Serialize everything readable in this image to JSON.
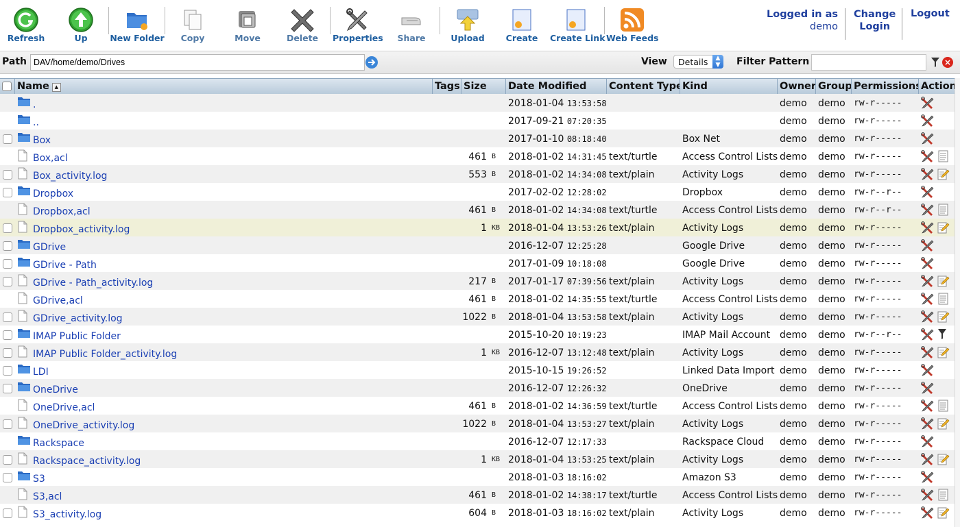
{
  "toolbar": {
    "buttons": [
      {
        "label": "Refresh",
        "icon": "refresh-icon"
      },
      {
        "label": "Up",
        "icon": "up-arrow-icon"
      },
      {
        "label": "New Folder",
        "icon": "new-folder-icon"
      },
      {
        "label": "Copy",
        "icon": "copy-icon"
      },
      {
        "label": "Move",
        "icon": "move-icon"
      },
      {
        "label": "Delete",
        "icon": "delete-x-icon"
      },
      {
        "label": "Properties",
        "icon": "wrench-screwdriver-icon"
      },
      {
        "label": "Share",
        "icon": "share-hand-icon"
      },
      {
        "label": "Upload",
        "icon": "upload-icon"
      },
      {
        "label": "Create",
        "icon": "create-file-icon"
      },
      {
        "label": "Create Link",
        "icon": "create-link-icon"
      },
      {
        "label": "Web Feeds",
        "icon": "rss-icon"
      }
    ],
    "logged_in_label": "Logged in as",
    "username": "demo",
    "change_login_line1": "Change",
    "change_login_line2": "Login",
    "logout_label": "Logout"
  },
  "pathbar": {
    "path_label": "Path",
    "path_value": "DAV/home/demo/Drives",
    "view_label": "View",
    "view_selected": "Details",
    "filter_label": "Filter Pattern",
    "filter_value": ""
  },
  "table": {
    "columns": [
      "Name",
      "Tags",
      "Size",
      "Date Modified",
      "Content Type",
      "Kind",
      "Owner",
      "Group",
      "Permissions",
      "Action"
    ],
    "rows": [
      {
        "type": "folder",
        "checkbox": false,
        "name": ".",
        "size": "",
        "unit": "",
        "date": "2018-01-04",
        "time": "13:53:58",
        "ctype": "",
        "kind": "",
        "owner": "demo",
        "group": "demo",
        "perm": "rw-r-----",
        "actions": [
          "properties"
        ]
      },
      {
        "type": "folder",
        "checkbox": false,
        "name": "..",
        "size": "",
        "unit": "",
        "date": "2017-09-21",
        "time": "07:20:35",
        "ctype": "",
        "kind": "",
        "owner": "demo",
        "group": "demo",
        "perm": "rw-r-----",
        "actions": [
          "properties"
        ]
      },
      {
        "type": "folder",
        "checkbox": true,
        "name": "Box",
        "size": "",
        "unit": "",
        "date": "2017-01-10",
        "time": "08:18:40",
        "ctype": "",
        "kind": "Box Net",
        "owner": "demo",
        "group": "demo",
        "perm": "rw-r-----",
        "actions": [
          "properties"
        ]
      },
      {
        "type": "file",
        "checkbox": false,
        "name": "Box,acl",
        "size": "461",
        "unit": "B",
        "date": "2018-01-02",
        "time": "14:31:45",
        "ctype": "text/turtle",
        "kind": "Access Control Lists",
        "owner": "demo",
        "group": "demo",
        "perm": "rw-r-----",
        "actions": [
          "properties",
          "view"
        ]
      },
      {
        "type": "file",
        "checkbox": true,
        "name": "Box_activity.log",
        "size": "553",
        "unit": "B",
        "date": "2018-01-02",
        "time": "14:34:08",
        "ctype": "text/plain",
        "kind": "Activity Logs",
        "owner": "demo",
        "group": "demo",
        "perm": "rw-r-----",
        "actions": [
          "properties",
          "edit"
        ]
      },
      {
        "type": "folder",
        "checkbox": true,
        "name": "Dropbox",
        "size": "",
        "unit": "",
        "date": "2017-02-02",
        "time": "12:28:02",
        "ctype": "",
        "kind": "Dropbox",
        "owner": "demo",
        "group": "demo",
        "perm": "rw-r--r--",
        "actions": [
          "properties"
        ]
      },
      {
        "type": "file",
        "checkbox": false,
        "name": "Dropbox,acl",
        "size": "461",
        "unit": "B",
        "date": "2018-01-02",
        "time": "14:34:08",
        "ctype": "text/turtle",
        "kind": "Access Control Lists",
        "owner": "demo",
        "group": "demo",
        "perm": "rw-r--r--",
        "actions": [
          "properties",
          "view"
        ]
      },
      {
        "type": "file",
        "checkbox": true,
        "name": "Dropbox_activity.log",
        "size": "1",
        "unit": "KB",
        "date": "2018-01-04",
        "time": "13:53:26",
        "ctype": "text/plain",
        "kind": "Activity Logs",
        "owner": "demo",
        "group": "demo",
        "perm": "rw-r-----",
        "actions": [
          "properties",
          "edit"
        ],
        "highlight": true
      },
      {
        "type": "folder",
        "checkbox": true,
        "name": "GDrive",
        "size": "",
        "unit": "",
        "date": "2016-12-07",
        "time": "12:25:28",
        "ctype": "",
        "kind": "Google Drive",
        "owner": "demo",
        "group": "demo",
        "perm": "rw-r-----",
        "actions": [
          "properties"
        ]
      },
      {
        "type": "folder",
        "checkbox": true,
        "name": "GDrive - Path",
        "size": "",
        "unit": "",
        "date": "2017-01-09",
        "time": "10:18:08",
        "ctype": "",
        "kind": "Google Drive",
        "owner": "demo",
        "group": "demo",
        "perm": "rw-r-----",
        "actions": [
          "properties"
        ]
      },
      {
        "type": "file",
        "checkbox": true,
        "name": "GDrive - Path_activity.log",
        "size": "217",
        "unit": "B",
        "date": "2017-01-17",
        "time": "07:39:56",
        "ctype": "text/plain",
        "kind": "Activity Logs",
        "owner": "demo",
        "group": "demo",
        "perm": "rw-r-----",
        "actions": [
          "properties",
          "edit"
        ]
      },
      {
        "type": "file",
        "checkbox": false,
        "name": "GDrive,acl",
        "size": "461",
        "unit": "B",
        "date": "2018-01-02",
        "time": "14:35:55",
        "ctype": "text/turtle",
        "kind": "Access Control Lists",
        "owner": "demo",
        "group": "demo",
        "perm": "rw-r-----",
        "actions": [
          "properties",
          "view"
        ]
      },
      {
        "type": "file",
        "checkbox": true,
        "name": "GDrive_activity.log",
        "size": "1022",
        "unit": "B",
        "date": "2018-01-04",
        "time": "13:53:58",
        "ctype": "text/plain",
        "kind": "Activity Logs",
        "owner": "demo",
        "group": "demo",
        "perm": "rw-r-----",
        "actions": [
          "properties",
          "edit"
        ]
      },
      {
        "type": "folder",
        "checkbox": true,
        "name": "IMAP Public Folder",
        "size": "",
        "unit": "",
        "date": "2015-10-20",
        "time": "10:19:23",
        "ctype": "",
        "kind": "IMAP Mail Account",
        "owner": "demo",
        "group": "demo",
        "perm": "rw-r--r--",
        "actions": [
          "properties",
          "filter"
        ]
      },
      {
        "type": "file",
        "checkbox": true,
        "name": "IMAP Public Folder_activity.log",
        "size": "1",
        "unit": "KB",
        "date": "2016-12-07",
        "time": "13:12:48",
        "ctype": "text/plain",
        "kind": "Activity Logs",
        "owner": "demo",
        "group": "demo",
        "perm": "rw-r-----",
        "actions": [
          "properties",
          "edit"
        ]
      },
      {
        "type": "folder",
        "checkbox": true,
        "name": "LDI",
        "size": "",
        "unit": "",
        "date": "2015-10-15",
        "time": "19:26:52",
        "ctype": "",
        "kind": "Linked Data Import",
        "owner": "demo",
        "group": "demo",
        "perm": "rw-r-----",
        "actions": [
          "properties"
        ]
      },
      {
        "type": "folder",
        "checkbox": true,
        "name": "OneDrive",
        "size": "",
        "unit": "",
        "date": "2016-12-07",
        "time": "12:26:32",
        "ctype": "",
        "kind": "OneDrive",
        "owner": "demo",
        "group": "demo",
        "perm": "rw-r-----",
        "actions": [
          "properties"
        ]
      },
      {
        "type": "file",
        "checkbox": false,
        "name": "OneDrive,acl",
        "size": "461",
        "unit": "B",
        "date": "2018-01-02",
        "time": "14:36:59",
        "ctype": "text/turtle",
        "kind": "Access Control Lists",
        "owner": "demo",
        "group": "demo",
        "perm": "rw-r-----",
        "actions": [
          "properties",
          "view"
        ]
      },
      {
        "type": "file",
        "checkbox": true,
        "name": "OneDrive_activity.log",
        "size": "1022",
        "unit": "B",
        "date": "2018-01-04",
        "time": "13:53:27",
        "ctype": "text/plain",
        "kind": "Activity Logs",
        "owner": "demo",
        "group": "demo",
        "perm": "rw-r-----",
        "actions": [
          "properties",
          "edit"
        ]
      },
      {
        "type": "folder",
        "checkbox": false,
        "name": "Rackspace",
        "size": "",
        "unit": "",
        "date": "2016-12-07",
        "time": "12:17:33",
        "ctype": "",
        "kind": "Rackspace Cloud",
        "owner": "demo",
        "group": "demo",
        "perm": "rw-r-----",
        "actions": [
          "properties"
        ]
      },
      {
        "type": "file",
        "checkbox": true,
        "name": "Rackspace_activity.log",
        "size": "1",
        "unit": "KB",
        "date": "2018-01-04",
        "time": "13:53:25",
        "ctype": "text/plain",
        "kind": "Activity Logs",
        "owner": "demo",
        "group": "demo",
        "perm": "rw-r-----",
        "actions": [
          "properties",
          "edit"
        ]
      },
      {
        "type": "folder",
        "checkbox": true,
        "name": "S3",
        "size": "",
        "unit": "",
        "date": "2018-01-03",
        "time": "18:16:02",
        "ctype": "",
        "kind": "Amazon S3",
        "owner": "demo",
        "group": "demo",
        "perm": "rw-r-----",
        "actions": [
          "properties"
        ]
      },
      {
        "type": "file",
        "checkbox": false,
        "name": "S3,acl",
        "size": "461",
        "unit": "B",
        "date": "2018-01-02",
        "time": "14:38:17",
        "ctype": "text/turtle",
        "kind": "Access Control Lists",
        "owner": "demo",
        "group": "demo",
        "perm": "rw-r-----",
        "actions": [
          "properties",
          "view"
        ]
      },
      {
        "type": "file",
        "checkbox": true,
        "name": "S3_activity.log",
        "size": "604",
        "unit": "B",
        "date": "2018-01-03",
        "time": "18:16:02",
        "ctype": "text/plain",
        "kind": "Activity Logs",
        "owner": "demo",
        "group": "demo",
        "perm": "rw-r-----",
        "actions": [
          "properties",
          "edit"
        ]
      }
    ]
  },
  "colors": {
    "link": "#1a3fb3",
    "header_bg": "#c7d6e4",
    "alt_row": "#f0f0f0",
    "highlight_row": "#f0f0d8",
    "folder_blue": "#3a7fd5"
  }
}
